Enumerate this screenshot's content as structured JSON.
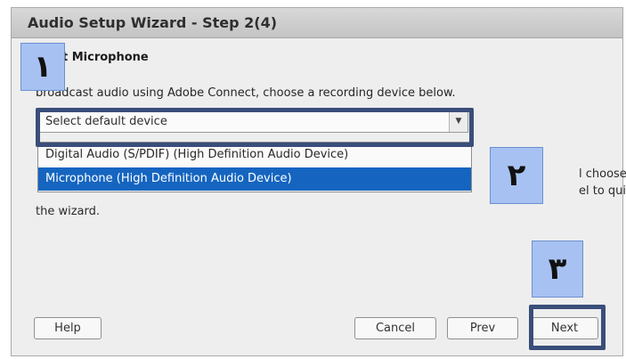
{
  "dialog": {
    "title": "Audio Setup Wizard - Step 2(4)",
    "heading_visible": "t Microphone",
    "instruction_visible": "broadcast audio using Adobe Connect, choose a recording device below."
  },
  "device_select": {
    "value": "Select default device",
    "options": [
      "Digital Audio (S/PDIF) (High Definition Audio Device)",
      "Microphone (High Definition Audio Device)"
    ],
    "selected_index": 1
  },
  "body_text": {
    "line1": "l choose",
    "line2": "el to quit",
    "line3": "the wizard."
  },
  "buttons": {
    "help": "Help",
    "cancel": "Cancel",
    "prev": "Prev",
    "next": "Next"
  },
  "annotations": {
    "marker_1": "١",
    "marker_2": "٢",
    "marker_3": "٣"
  },
  "colors": {
    "selection": "#1565c0",
    "marker_fill": "#a7c2f2",
    "highlight_border": "#3a4e7a"
  },
  "icons": {
    "select_arrow": "chevron-down-icon"
  }
}
